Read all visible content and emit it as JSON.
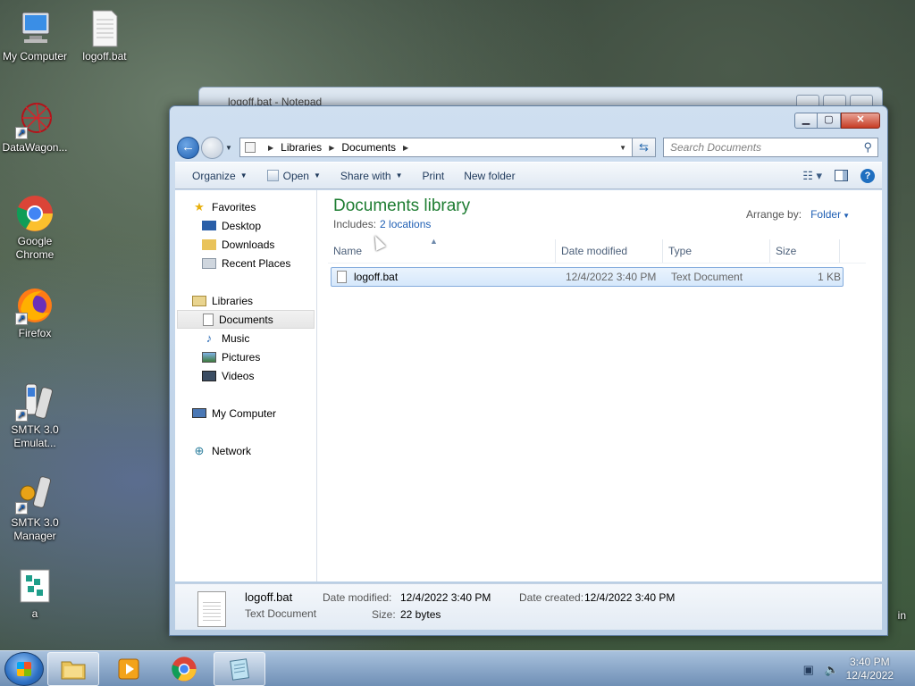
{
  "desktop": {
    "icons": [
      {
        "label": "My Computer",
        "icon": "computer-icon"
      },
      {
        "label": "logoff.bat",
        "icon": "text-file-icon"
      },
      {
        "label": "DataWagon...",
        "icon": "datawagon-icon"
      },
      {
        "label": "Google Chrome",
        "icon": "chrome-icon"
      },
      {
        "label": "Firefox",
        "icon": "firefox-icon"
      },
      {
        "label": "SMTK 3.0 Emulat...",
        "icon": "phone-icon"
      },
      {
        "label": "SMTK 3.0 Manager",
        "icon": "phone-manager-icon"
      },
      {
        "label": "a",
        "icon": "cubes-icon"
      }
    ],
    "partial_label": "in"
  },
  "notepad": {
    "title": "logoff.bat - Notepad"
  },
  "explorer": {
    "address": [
      "Libraries",
      "Documents"
    ],
    "search_placeholder": "Search Documents",
    "commands": {
      "organize": "Organize",
      "open": "Open",
      "share_with": "Share with",
      "print": "Print",
      "new_folder": "New folder"
    },
    "nav": {
      "favorites": "Favorites",
      "desktop": "Desktop",
      "downloads": "Downloads",
      "recent_places": "Recent Places",
      "libraries": "Libraries",
      "documents": "Documents",
      "music": "Music",
      "pictures": "Pictures",
      "videos": "Videos",
      "my_computer": "My Computer",
      "network": "Network"
    },
    "library": {
      "title": "Documents library",
      "includes_label": "Includes:",
      "includes_link": "2 locations",
      "arrange_label": "Arrange by:",
      "arrange_value": "Folder"
    },
    "columns": [
      "Name",
      "Date modified",
      "Type",
      "Size"
    ],
    "files": [
      {
        "name": "logoff.bat",
        "date_modified": "12/4/2022 3:40 PM",
        "type": "Text Document",
        "size": "1 KB"
      }
    ],
    "details": {
      "name": "logoff.bat",
      "type": "Text Document",
      "date_modified_label": "Date modified:",
      "date_modified": "12/4/2022 3:40 PM",
      "date_created_label": "Date created:",
      "date_created": "12/4/2022 3:40 PM",
      "size_label": "Size:",
      "size": "22 bytes"
    }
  },
  "taskbar": {
    "time": "3:40 PM",
    "date": "12/4/2022"
  }
}
